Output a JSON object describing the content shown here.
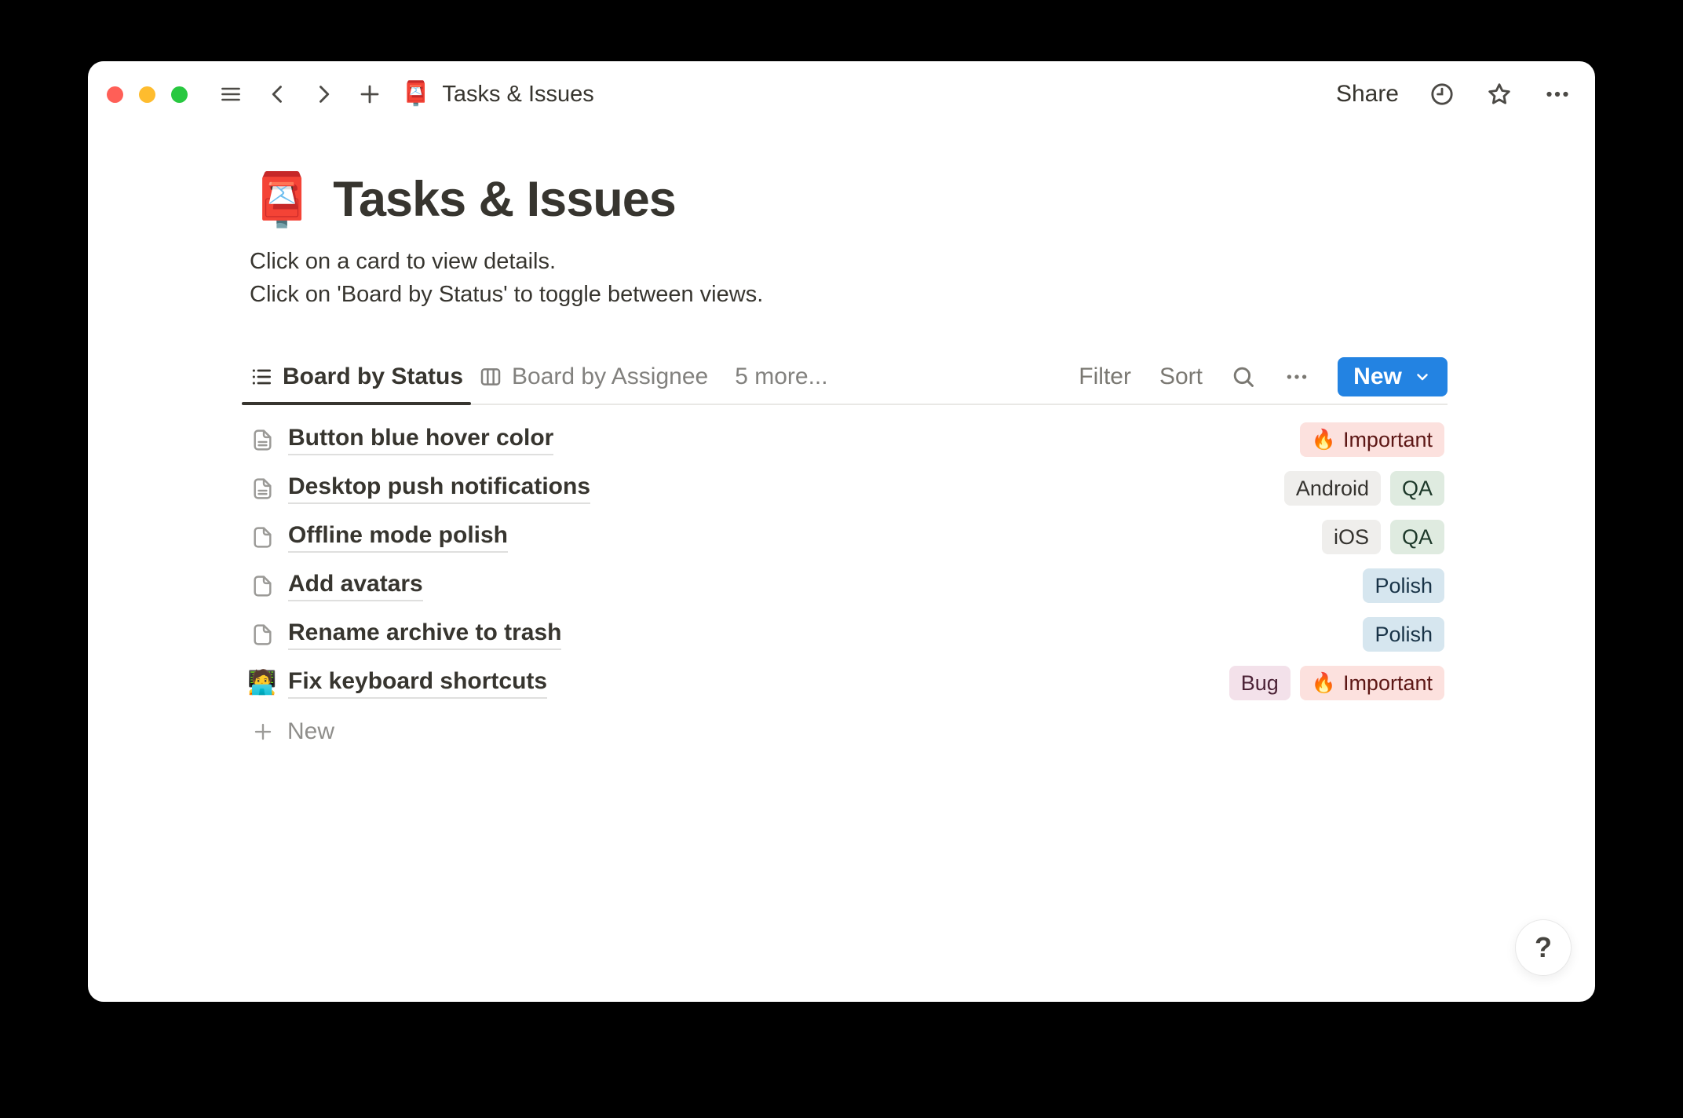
{
  "toolbar": {
    "page_emoji": "📮",
    "title": "Tasks & Issues",
    "share_label": "Share"
  },
  "page": {
    "emoji": "📮",
    "title": "Tasks & Issues",
    "description": [
      "Click on a card to view details.",
      "Click on 'Board by Status' to toggle between views."
    ],
    "views": {
      "tabs": [
        {
          "label": "Board by Status",
          "icon": "list-view-icon",
          "active": true
        },
        {
          "label": "Board by Assignee",
          "icon": "board-view-icon",
          "active": false
        }
      ],
      "more_label": "5 more...",
      "filter_label": "Filter",
      "sort_label": "Sort",
      "new_button_label": "New"
    },
    "items": [
      {
        "icon": "page-with-text",
        "title": "Button blue hover color",
        "tags": [
          {
            "emoji": "🔥",
            "label": "Important",
            "color": "red"
          }
        ]
      },
      {
        "icon": "page-with-text",
        "title": "Desktop push notifications",
        "tags": [
          {
            "label": "Android",
            "color": "gray"
          },
          {
            "label": "QA",
            "color": "green"
          }
        ]
      },
      {
        "icon": "page-empty",
        "title": "Offline mode polish",
        "tags": [
          {
            "label": "iOS",
            "color": "gray"
          },
          {
            "label": "QA",
            "color": "green"
          }
        ]
      },
      {
        "icon": "page-empty",
        "title": "Add avatars",
        "tags": [
          {
            "label": "Polish",
            "color": "blue"
          }
        ]
      },
      {
        "icon": "page-empty",
        "title": "Rename archive to trash",
        "tags": [
          {
            "label": "Polish",
            "color": "blue"
          }
        ]
      },
      {
        "icon": "emoji",
        "emoji": "🧑‍💻",
        "title": "Fix keyboard shortcuts",
        "tags": [
          {
            "label": "Bug",
            "color": "pink"
          },
          {
            "emoji": "🔥",
            "label": "Important",
            "color": "red"
          }
        ]
      }
    ],
    "new_row_label": "New",
    "help_label": "?"
  },
  "colors": {
    "accent_blue": "#2383E2",
    "tag_red_bg": "#FCE1DE",
    "tag_red_text": "#5D1715",
    "tag_gray_bg": "#EFEEEC",
    "tag_gray_text": "#34322E",
    "tag_green_bg": "#DFEBE0",
    "tag_green_text": "#1C3829",
    "tag_blue_bg": "#D6E6EF",
    "tag_blue_text": "#183347",
    "tag_pink_bg": "#F3E1EA",
    "tag_pink_text": "#4C2337",
    "traffic_red": "#FF5F57",
    "traffic_yellow": "#FEBC2E",
    "traffic_green": "#28C840"
  }
}
